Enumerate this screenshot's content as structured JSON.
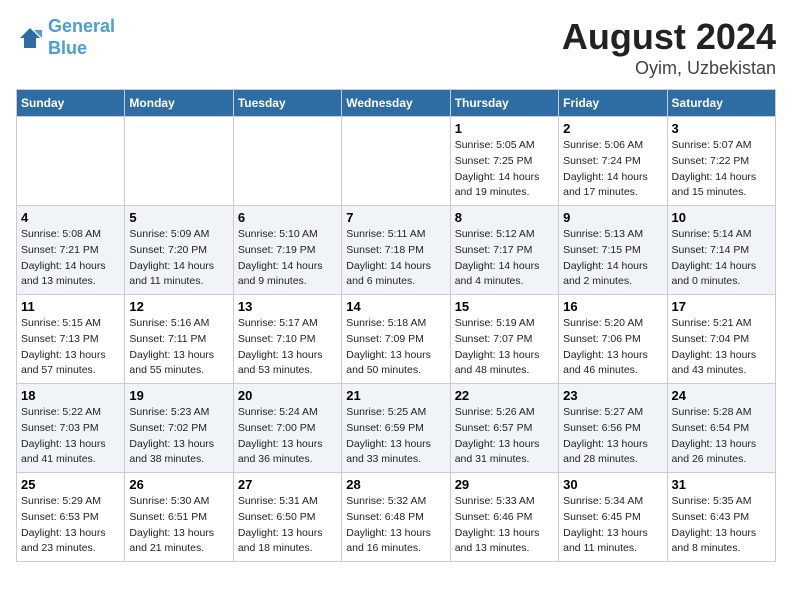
{
  "header": {
    "logo_line1": "General",
    "logo_line2": "Blue",
    "title": "August 2024",
    "subtitle": "Oyim, Uzbekistan"
  },
  "days_of_week": [
    "Sunday",
    "Monday",
    "Tuesday",
    "Wednesday",
    "Thursday",
    "Friday",
    "Saturday"
  ],
  "weeks": [
    [
      {
        "num": "",
        "info": ""
      },
      {
        "num": "",
        "info": ""
      },
      {
        "num": "",
        "info": ""
      },
      {
        "num": "",
        "info": ""
      },
      {
        "num": "1",
        "info": "Sunrise: 5:05 AM\nSunset: 7:25 PM\nDaylight: 14 hours\nand 19 minutes."
      },
      {
        "num": "2",
        "info": "Sunrise: 5:06 AM\nSunset: 7:24 PM\nDaylight: 14 hours\nand 17 minutes."
      },
      {
        "num": "3",
        "info": "Sunrise: 5:07 AM\nSunset: 7:22 PM\nDaylight: 14 hours\nand 15 minutes."
      }
    ],
    [
      {
        "num": "4",
        "info": "Sunrise: 5:08 AM\nSunset: 7:21 PM\nDaylight: 14 hours\nand 13 minutes."
      },
      {
        "num": "5",
        "info": "Sunrise: 5:09 AM\nSunset: 7:20 PM\nDaylight: 14 hours\nand 11 minutes."
      },
      {
        "num": "6",
        "info": "Sunrise: 5:10 AM\nSunset: 7:19 PM\nDaylight: 14 hours\nand 9 minutes."
      },
      {
        "num": "7",
        "info": "Sunrise: 5:11 AM\nSunset: 7:18 PM\nDaylight: 14 hours\nand 6 minutes."
      },
      {
        "num": "8",
        "info": "Sunrise: 5:12 AM\nSunset: 7:17 PM\nDaylight: 14 hours\nand 4 minutes."
      },
      {
        "num": "9",
        "info": "Sunrise: 5:13 AM\nSunset: 7:15 PM\nDaylight: 14 hours\nand 2 minutes."
      },
      {
        "num": "10",
        "info": "Sunrise: 5:14 AM\nSunset: 7:14 PM\nDaylight: 14 hours\nand 0 minutes."
      }
    ],
    [
      {
        "num": "11",
        "info": "Sunrise: 5:15 AM\nSunset: 7:13 PM\nDaylight: 13 hours\nand 57 minutes."
      },
      {
        "num": "12",
        "info": "Sunrise: 5:16 AM\nSunset: 7:11 PM\nDaylight: 13 hours\nand 55 minutes."
      },
      {
        "num": "13",
        "info": "Sunrise: 5:17 AM\nSunset: 7:10 PM\nDaylight: 13 hours\nand 53 minutes."
      },
      {
        "num": "14",
        "info": "Sunrise: 5:18 AM\nSunset: 7:09 PM\nDaylight: 13 hours\nand 50 minutes."
      },
      {
        "num": "15",
        "info": "Sunrise: 5:19 AM\nSunset: 7:07 PM\nDaylight: 13 hours\nand 48 minutes."
      },
      {
        "num": "16",
        "info": "Sunrise: 5:20 AM\nSunset: 7:06 PM\nDaylight: 13 hours\nand 46 minutes."
      },
      {
        "num": "17",
        "info": "Sunrise: 5:21 AM\nSunset: 7:04 PM\nDaylight: 13 hours\nand 43 minutes."
      }
    ],
    [
      {
        "num": "18",
        "info": "Sunrise: 5:22 AM\nSunset: 7:03 PM\nDaylight: 13 hours\nand 41 minutes."
      },
      {
        "num": "19",
        "info": "Sunrise: 5:23 AM\nSunset: 7:02 PM\nDaylight: 13 hours\nand 38 minutes."
      },
      {
        "num": "20",
        "info": "Sunrise: 5:24 AM\nSunset: 7:00 PM\nDaylight: 13 hours\nand 36 minutes."
      },
      {
        "num": "21",
        "info": "Sunrise: 5:25 AM\nSunset: 6:59 PM\nDaylight: 13 hours\nand 33 minutes."
      },
      {
        "num": "22",
        "info": "Sunrise: 5:26 AM\nSunset: 6:57 PM\nDaylight: 13 hours\nand 31 minutes."
      },
      {
        "num": "23",
        "info": "Sunrise: 5:27 AM\nSunset: 6:56 PM\nDaylight: 13 hours\nand 28 minutes."
      },
      {
        "num": "24",
        "info": "Sunrise: 5:28 AM\nSunset: 6:54 PM\nDaylight: 13 hours\nand 26 minutes."
      }
    ],
    [
      {
        "num": "25",
        "info": "Sunrise: 5:29 AM\nSunset: 6:53 PM\nDaylight: 13 hours\nand 23 minutes."
      },
      {
        "num": "26",
        "info": "Sunrise: 5:30 AM\nSunset: 6:51 PM\nDaylight: 13 hours\nand 21 minutes."
      },
      {
        "num": "27",
        "info": "Sunrise: 5:31 AM\nSunset: 6:50 PM\nDaylight: 13 hours\nand 18 minutes."
      },
      {
        "num": "28",
        "info": "Sunrise: 5:32 AM\nSunset: 6:48 PM\nDaylight: 13 hours\nand 16 minutes."
      },
      {
        "num": "29",
        "info": "Sunrise: 5:33 AM\nSunset: 6:46 PM\nDaylight: 13 hours\nand 13 minutes."
      },
      {
        "num": "30",
        "info": "Sunrise: 5:34 AM\nSunset: 6:45 PM\nDaylight: 13 hours\nand 11 minutes."
      },
      {
        "num": "31",
        "info": "Sunrise: 5:35 AM\nSunset: 6:43 PM\nDaylight: 13 hours\nand 8 minutes."
      }
    ]
  ]
}
